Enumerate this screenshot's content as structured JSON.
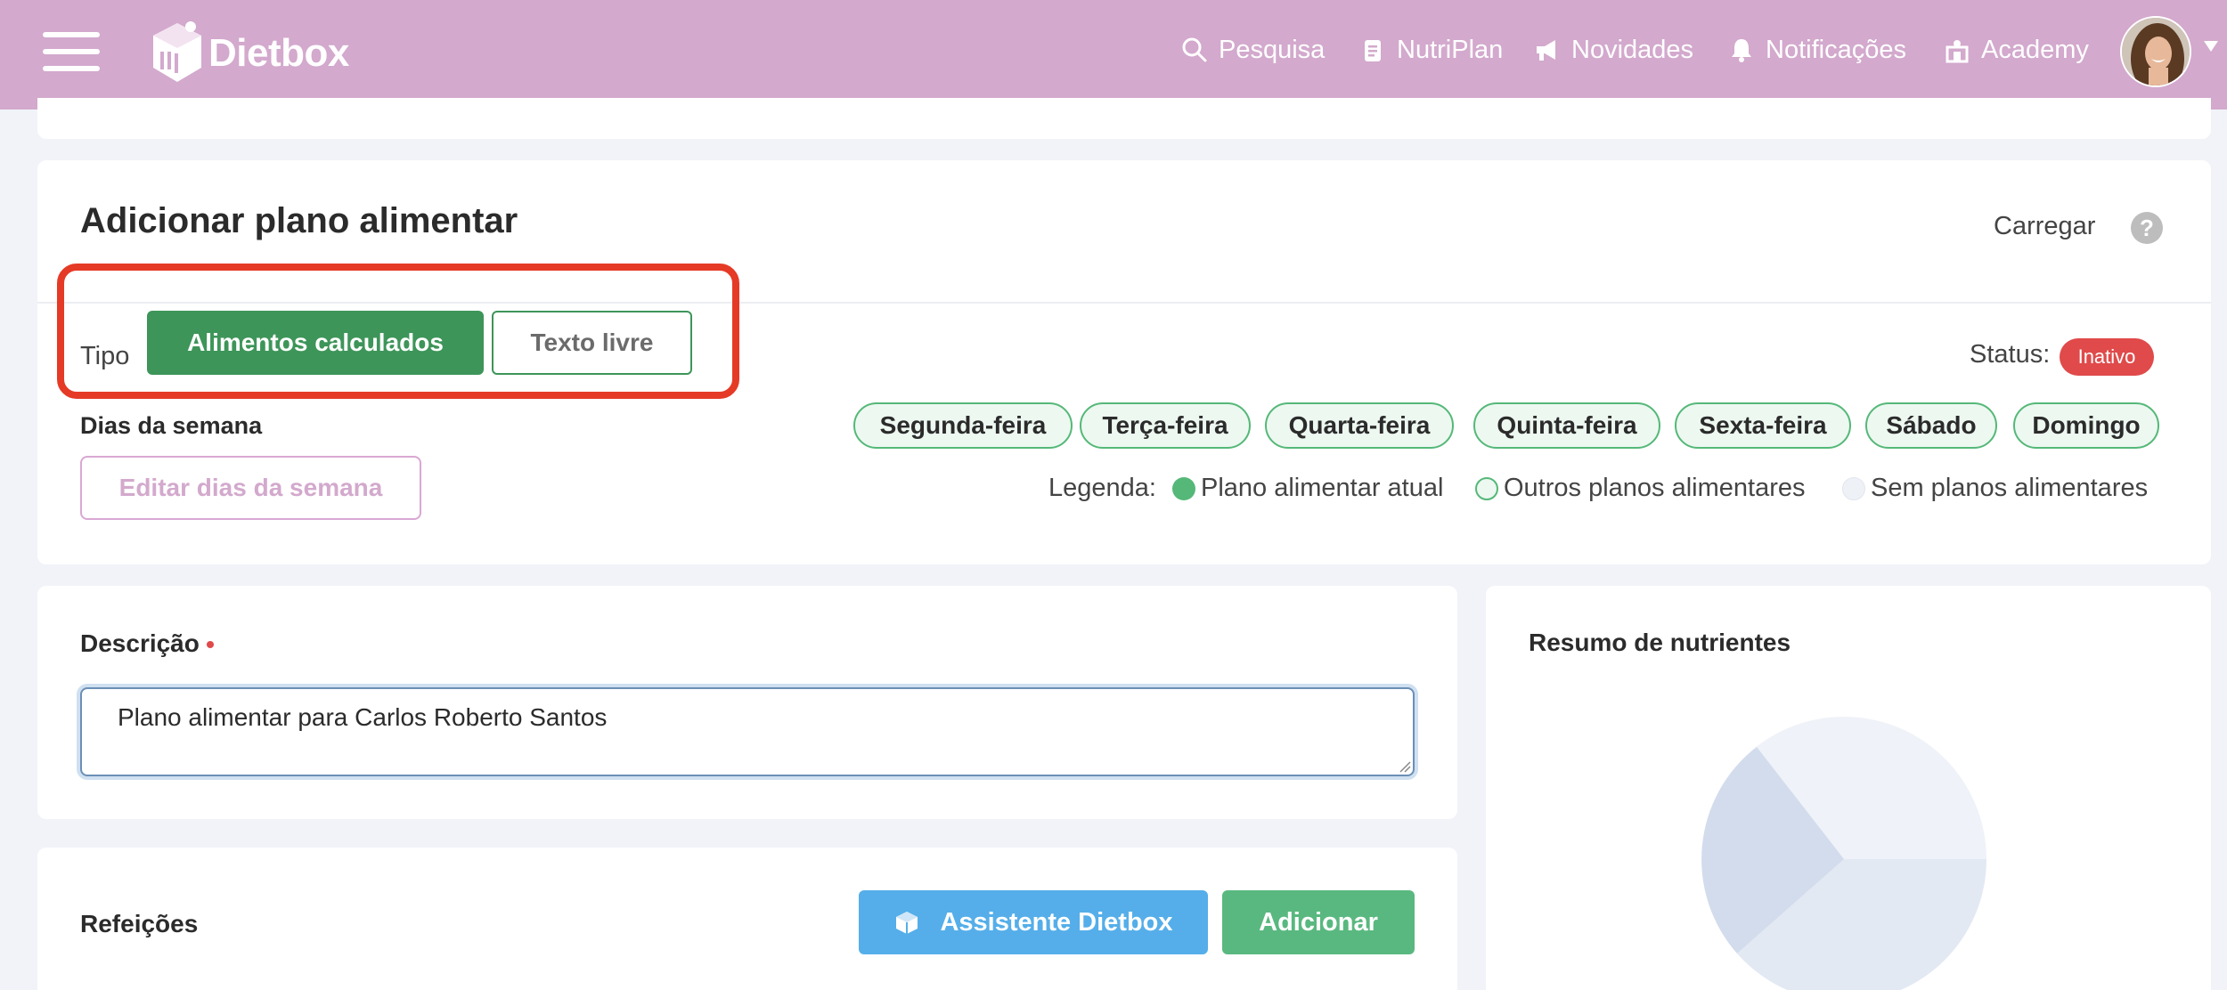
{
  "header": {
    "brand": "Dietbox",
    "nav": [
      {
        "label": "Pesquisa",
        "icon": "search-icon"
      },
      {
        "label": "NutriPlan",
        "icon": "clipboard-icon"
      },
      {
        "label": "Novidades",
        "icon": "megaphone-icon"
      },
      {
        "label": "Notificações",
        "icon": "bell-icon"
      },
      {
        "label": "Academy",
        "icon": "academy-icon"
      }
    ],
    "colors": {
      "bar": "#d3a9cd",
      "text": "#ffffff"
    }
  },
  "plan": {
    "title": "Adicionar plano alimentar",
    "load_label": "Carregar",
    "help_glyph": "?",
    "type_label": "Tipo",
    "type_options": [
      "Alimentos calculados",
      "Texto livre"
    ],
    "type_selected": "Alimentos calculados",
    "status_label": "Status:",
    "status_value": "Inativo",
    "weekdays_label": "Dias da semana",
    "weekdays": [
      "Segunda-feira",
      "Terça-feira",
      "Quarta-feira",
      "Quinta-feira",
      "Sexta-feira",
      "Sábado",
      "Domingo"
    ],
    "edit_weekdays_label": "Editar dias da semana",
    "legend_label": "Legenda:",
    "legend": [
      "Plano alimentar atual",
      "Outros planos alimentares",
      "Sem planos alimentares"
    ],
    "colors": {
      "primary": "#3d9559",
      "danger": "#e04a4a",
      "highlight": "#e53a26"
    }
  },
  "description": {
    "label": "Descrição",
    "value": "Plano alimentar para Carlos Roberto Santos"
  },
  "meals": {
    "label": "Refeições",
    "assistant_label": "Assistente Dietbox",
    "add_label": "Adicionar",
    "colors": {
      "assistant": "#55aee9",
      "add": "#59b87f"
    }
  },
  "nutrients": {
    "title": "Resumo de nutrientes"
  }
}
